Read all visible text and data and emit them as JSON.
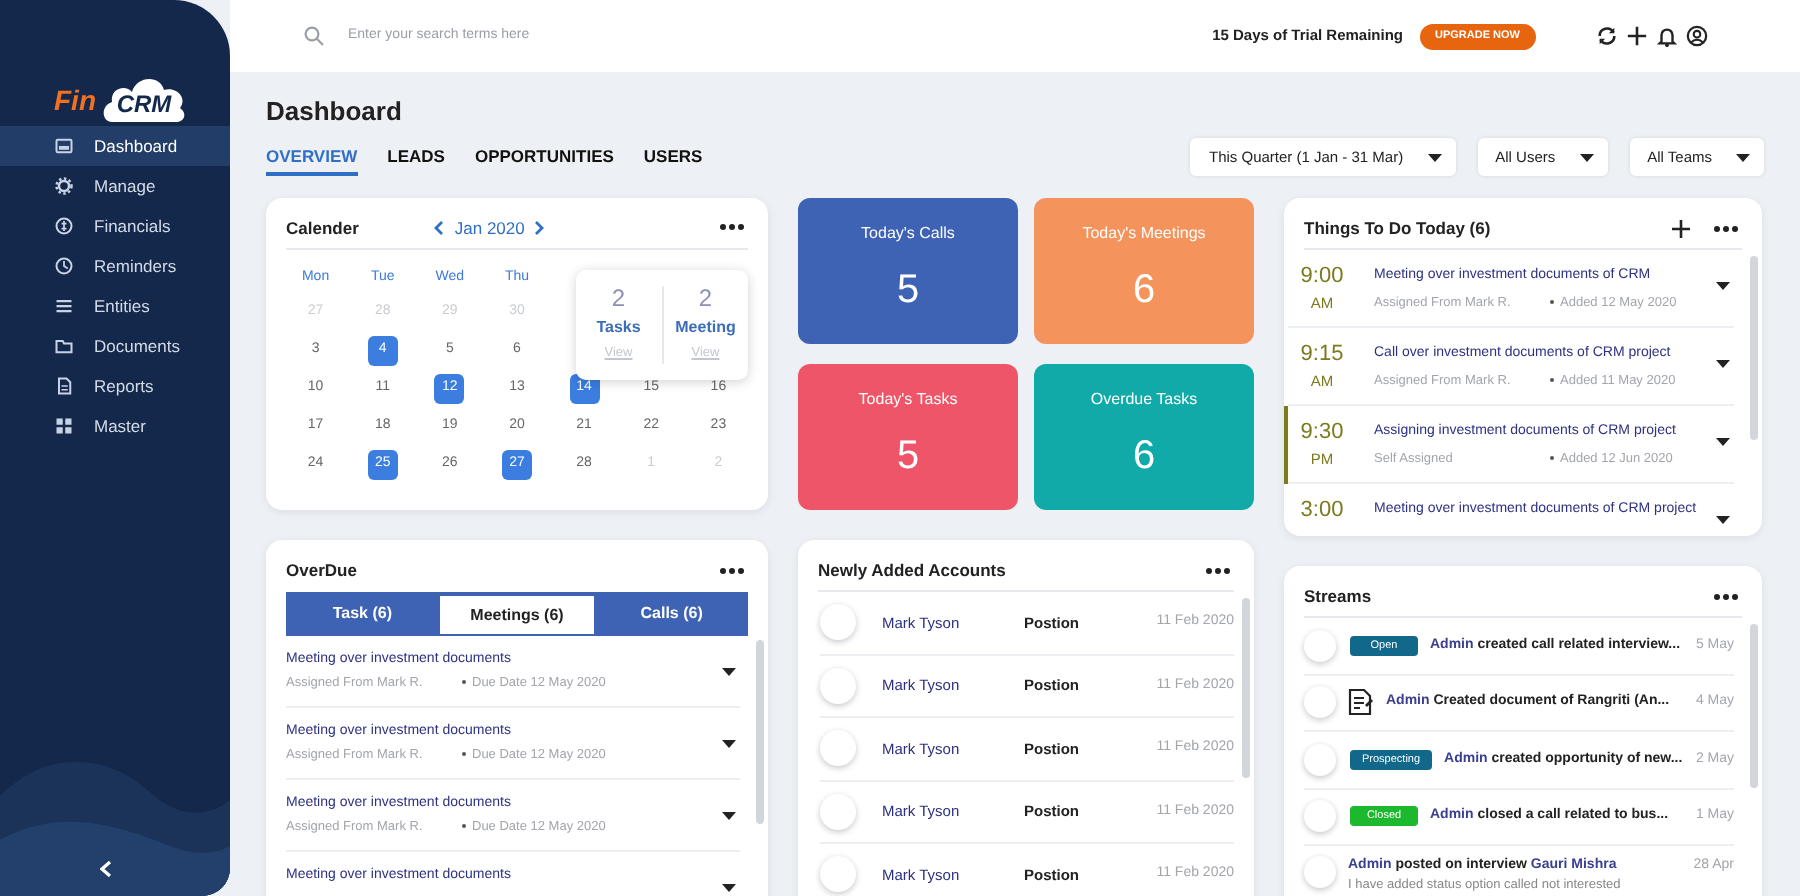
{
  "logo": {
    "prefix": "Fin",
    "name": "CRM"
  },
  "sidebar": {
    "items": [
      {
        "label": "Dashboard",
        "selected": true
      },
      {
        "label": "Manage",
        "selected": false
      },
      {
        "label": "Financials",
        "selected": false
      },
      {
        "label": "Reminders",
        "selected": false
      },
      {
        "label": "Entities",
        "selected": false
      },
      {
        "label": "Documents",
        "selected": false
      },
      {
        "label": "Reports",
        "selected": false
      },
      {
        "label": "Master",
        "selected": false
      }
    ]
  },
  "topbar": {
    "search": {
      "placeholder": "Enter your search terms here"
    },
    "trial": "15 Days of Trial Remaining",
    "upgrade": "UPGRADE NOW"
  },
  "page": {
    "title": "Dashboard",
    "tabs": [
      {
        "label": "OVERVIEW",
        "selected": true
      },
      {
        "label": "LEADS",
        "selected": false
      },
      {
        "label": "OPPORTUNITIES",
        "selected": false
      },
      {
        "label": "USERS",
        "selected": false
      }
    ],
    "filters": [
      "This Quarter (1 Jan - 31 Mar)",
      "All Users",
      "All Teams"
    ]
  },
  "calendar": {
    "title": "Calender",
    "month": "Jan 2020",
    "weekdays": [
      "Mon",
      "Tue",
      "Wed",
      "Thu"
    ],
    "weeks": [
      {
        "days": [
          {
            "label": "27",
            "muted": true,
            "highlighted": false
          },
          {
            "label": "28",
            "muted": true,
            "highlighted": false
          },
          {
            "label": "29",
            "muted": true,
            "highlighted": false
          },
          {
            "label": "30",
            "muted": true,
            "highlighted": false
          }
        ]
      },
      {
        "days": [
          {
            "label": "3",
            "muted": false,
            "highlighted": false
          },
          {
            "label": "4",
            "muted": false,
            "highlighted": true
          },
          {
            "label": "5",
            "muted": false,
            "highlighted": false
          },
          {
            "label": "6",
            "muted": false,
            "highlighted": false
          }
        ]
      },
      {
        "days": [
          {
            "label": "10",
            "muted": false,
            "highlighted": false
          },
          {
            "label": "11",
            "muted": false,
            "highlighted": false
          },
          {
            "label": "12",
            "muted": false,
            "highlighted": true
          },
          {
            "label": "13",
            "muted": false,
            "highlighted": false
          },
          {
            "label": "14",
            "muted": false,
            "highlighted": true
          },
          {
            "label": "15",
            "muted": false,
            "highlighted": false
          },
          {
            "label": "16",
            "muted": false,
            "highlighted": false
          }
        ]
      },
      {
        "days": [
          {
            "label": "17",
            "muted": false,
            "highlighted": false
          },
          {
            "label": "18",
            "muted": false,
            "highlighted": false
          },
          {
            "label": "19",
            "muted": false,
            "highlighted": false
          },
          {
            "label": "20",
            "muted": false,
            "highlighted": false
          },
          {
            "label": "21",
            "muted": false,
            "highlighted": false
          },
          {
            "label": "22",
            "muted": false,
            "highlighted": false
          },
          {
            "label": "23",
            "muted": false,
            "highlighted": false
          }
        ]
      },
      {
        "days": [
          {
            "label": "24",
            "muted": false,
            "highlighted": false
          },
          {
            "label": "25",
            "muted": false,
            "highlighted": true
          },
          {
            "label": "26",
            "muted": false,
            "highlighted": false
          },
          {
            "label": "27",
            "muted": false,
            "highlighted": true
          },
          {
            "label": "28",
            "muted": false,
            "highlighted": false
          },
          {
            "label": "1",
            "muted": true,
            "highlighted": false
          },
          {
            "label": "2",
            "muted": true,
            "highlighted": false
          }
        ]
      }
    ],
    "popover": {
      "items": [
        {
          "count": "2",
          "label": "Tasks",
          "action": "View"
        },
        {
          "count": "2",
          "label": "Meeting",
          "action": "View"
        }
      ]
    }
  },
  "stats": [
    {
      "label": "Today's Calls",
      "value": "5",
      "color": "#3e62b4"
    },
    {
      "label": "Today's Meetings",
      "value": "6",
      "color": "#f5935c"
    },
    {
      "label": "Today's Tasks",
      "value": "5",
      "color": "#ef5568"
    },
    {
      "label": "Overdue Tasks",
      "value": "6",
      "color": "#10aaa8"
    }
  ],
  "todo": {
    "title": "Things To Do Today (6)",
    "items": [
      {
        "time": "9:00",
        "period": "AM",
        "title": "Meeting over investment documents of CRM",
        "assignee": "Assigned From Mark R.",
        "added": "Added 12 May 2020",
        "selected": false
      },
      {
        "time": "9:15",
        "period": "AM",
        "title": "Call over investment documents of CRM project",
        "assignee": "Assigned From Mark R.",
        "added": "Added 11 May 2020",
        "selected": false
      },
      {
        "time": "9:30",
        "period": "PM",
        "title": "Assigning investment documents of CRM project",
        "assignee": "Self Assigned",
        "added": "Added 12 Jun 2020",
        "selected": true
      },
      {
        "time": "3:00",
        "title": "Meeting over investment documents of CRM project",
        "selected": false
      }
    ]
  },
  "overdue": {
    "title": "OverDue",
    "tabs": [
      {
        "label": "Task (6)",
        "selected": false
      },
      {
        "label": "Meetings (6)",
        "selected": true
      },
      {
        "label": "Calls (6)",
        "selected": false
      }
    ],
    "items": [
      {
        "title": "Meeting over investment documents",
        "assignee": "Assigned From Mark R.",
        "due": "Due Date 12 May 2020"
      },
      {
        "title": "Meeting over investment documents",
        "assignee": "Assigned From Mark R.",
        "due": "Due Date 12 May 2020"
      },
      {
        "title": "Meeting over investment documents",
        "assignee": "Assigned From Mark R.",
        "due": "Due Date 12 May 2020"
      },
      {
        "title": "Meeting over investment documents"
      }
    ]
  },
  "accounts": {
    "title": "Newly Added Accounts",
    "rows": [
      {
        "name": "Mark Tyson",
        "position": "Postion",
        "date": "11 Feb 2020"
      },
      {
        "name": "Mark Tyson",
        "position": "Postion",
        "date": "11 Feb 2020"
      },
      {
        "name": "Mark Tyson",
        "position": "Postion",
        "date": "11 Feb 2020"
      },
      {
        "name": "Mark Tyson",
        "position": "Postion",
        "date": "11 Feb 2020"
      },
      {
        "name": "Mark Tyson",
        "position": "Postion",
        "date": "11 Feb 2020"
      }
    ]
  },
  "streams": {
    "title": "Streams",
    "items": [
      {
        "kind": "badge",
        "badge": "Open",
        "color": "#12688a",
        "actor": "Admin",
        "text": "created call related interview...",
        "date": "5 May"
      },
      {
        "kind": "document",
        "actor": "Admin",
        "text": "Created document of Rangriti (An...",
        "date": "4 May"
      },
      {
        "kind": "badge",
        "badge": "Prospecting",
        "color": "#12688a",
        "actor": "Admin",
        "text": "created opportunity of new...",
        "date": "2 May"
      },
      {
        "kind": "badge",
        "badge": "Closed",
        "color": "#1cb82e",
        "actor": "Admin",
        "text": "closed a call related to bus...",
        "date": "1 May"
      },
      {
        "kind": "post",
        "actor": "Admin",
        "text": "posted on interview",
        "target": "Gauri Mishra",
        "note": "I have added status option called not interested",
        "date": "28 Apr"
      }
    ]
  }
}
